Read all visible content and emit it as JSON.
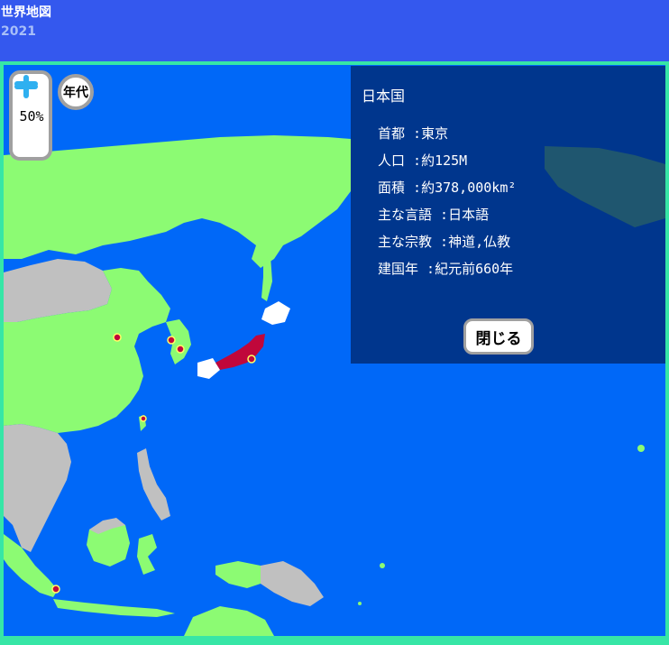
{
  "app": {
    "title": "世界地図",
    "year": "2021"
  },
  "map_controls": {
    "zoom_level": "50%",
    "era_label": "年代"
  },
  "info_panel": {
    "country": "日本国",
    "rows": [
      {
        "label": "首都",
        "value": "東京"
      },
      {
        "label": "人口",
        "value": "約125M"
      },
      {
        "label": "面積",
        "value": "約378,000km²"
      },
      {
        "label": "主な言語",
        "value": "日本語"
      },
      {
        "label": "主な宗教",
        "value": "神道,仏教"
      },
      {
        "label": "建国年",
        "value": "紀元前660年"
      }
    ],
    "close_label": "閉じる"
  },
  "colors": {
    "header": "#3458ee",
    "ocean": "#0068f8",
    "land_default": "#8cfb73",
    "land_unavailable": "#c0c0c0",
    "selected_country": "#c0073b",
    "frame": "#37e6a6"
  }
}
